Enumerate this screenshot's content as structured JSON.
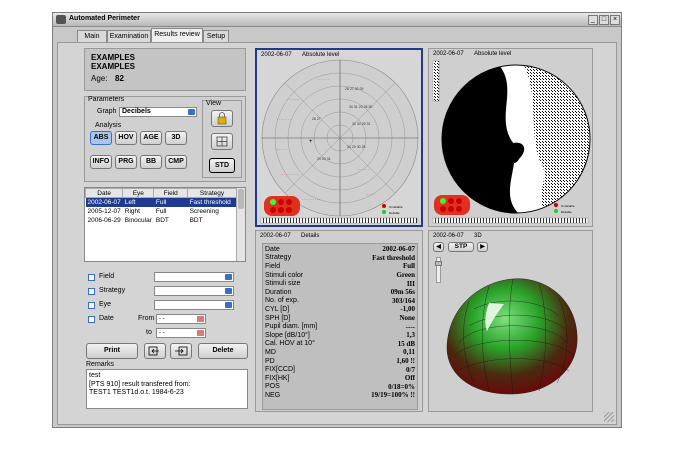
{
  "window": {
    "title": "Automated Perimeter",
    "controls": [
      "_",
      "□",
      "×"
    ]
  },
  "tabs": [
    {
      "label": "Main",
      "active": false
    },
    {
      "label": "Examination",
      "active": false
    },
    {
      "label": "Results review",
      "active": true
    },
    {
      "label": "Setup",
      "active": false
    }
  ],
  "patient": {
    "line1": "EXAMPLES",
    "line2": "EXAMPLES",
    "age_label": "Age:",
    "age_value": "82"
  },
  "parameters": {
    "group_label": "Parameters",
    "graph_label": "Graph",
    "graph_value": "Decibels",
    "analysis_label": "Analysis",
    "analysis_buttons_row1": [
      "ABS",
      "HOV",
      "AGE",
      "3D"
    ],
    "analysis_buttons_row2": [
      "INFO",
      "PRG",
      "BB",
      "CMP"
    ],
    "active_analysis": "ABS",
    "view_label": "View",
    "std_label": "STD"
  },
  "exam_table": {
    "columns": [
      "Date",
      "Eye",
      "Field",
      "Strategy"
    ],
    "rows": [
      [
        "2002-06-07",
        "Left",
        "Full",
        "Fast threshold"
      ],
      [
        "2005-12-07",
        "Right",
        "Full",
        "Screening"
      ],
      [
        "2006-06-29",
        "Binocular",
        "BDT",
        "BDT"
      ]
    ],
    "selected_row": 0
  },
  "filters": {
    "field_label": "Field",
    "strategy_label": "Strategy",
    "eye_label": "Eye",
    "date_label": "Date",
    "from_label": "From",
    "to_label": "to",
    "from_value": "-  -",
    "to_value": "-  -"
  },
  "actions": {
    "print": "Print",
    "delete": "Delete"
  },
  "remarks": {
    "label": "Remarks",
    "lines": [
      "test",
      "[PTS 910] result transfered from:",
      "TEST1 TEST1d.o.t.  1984-6-23"
    ]
  },
  "plots": {
    "top_left": {
      "date": "2002-06-07",
      "title": "Absolute level"
    },
    "top_right": {
      "date": "2002-06-07",
      "title": "Absolute level"
    },
    "details": {
      "date": "2002-06-07",
      "title": "Details"
    },
    "three_d": {
      "date": "2002-06-07",
      "title": "3D",
      "stp_label": "STP"
    },
    "legend": [
      "Unreliable",
      "Reliable"
    ]
  },
  "details_rows": [
    [
      "Date",
      "2002-06-07"
    ],
    [
      "Strategy",
      "Fast threshold"
    ],
    [
      "Field",
      "Full"
    ],
    [
      "Stimuli color",
      "Green"
    ],
    [
      "Stimuli size",
      "III"
    ],
    [
      "Duration",
      "09m 56s"
    ],
    [
      "No. of exp.",
      "303/164"
    ],
    [
      "CYL [D]",
      "-1,00"
    ],
    [
      "SPH [D]",
      "None"
    ],
    [
      "Pupil diam. [mm]",
      "----"
    ],
    [
      "Slope [dB/10°]",
      "1,3"
    ],
    [
      "Cal. HOV at 10°",
      "15 dB"
    ],
    [
      "MD",
      "0,11"
    ],
    [
      "PD",
      "1,60 !!"
    ],
    [
      "FIX[CCD]",
      "0/7"
    ],
    [
      "FIX[HK]",
      "Off"
    ],
    [
      "POS",
      "0/18=0%"
    ],
    [
      "NEG",
      "19/19=100% !!"
    ]
  ]
}
